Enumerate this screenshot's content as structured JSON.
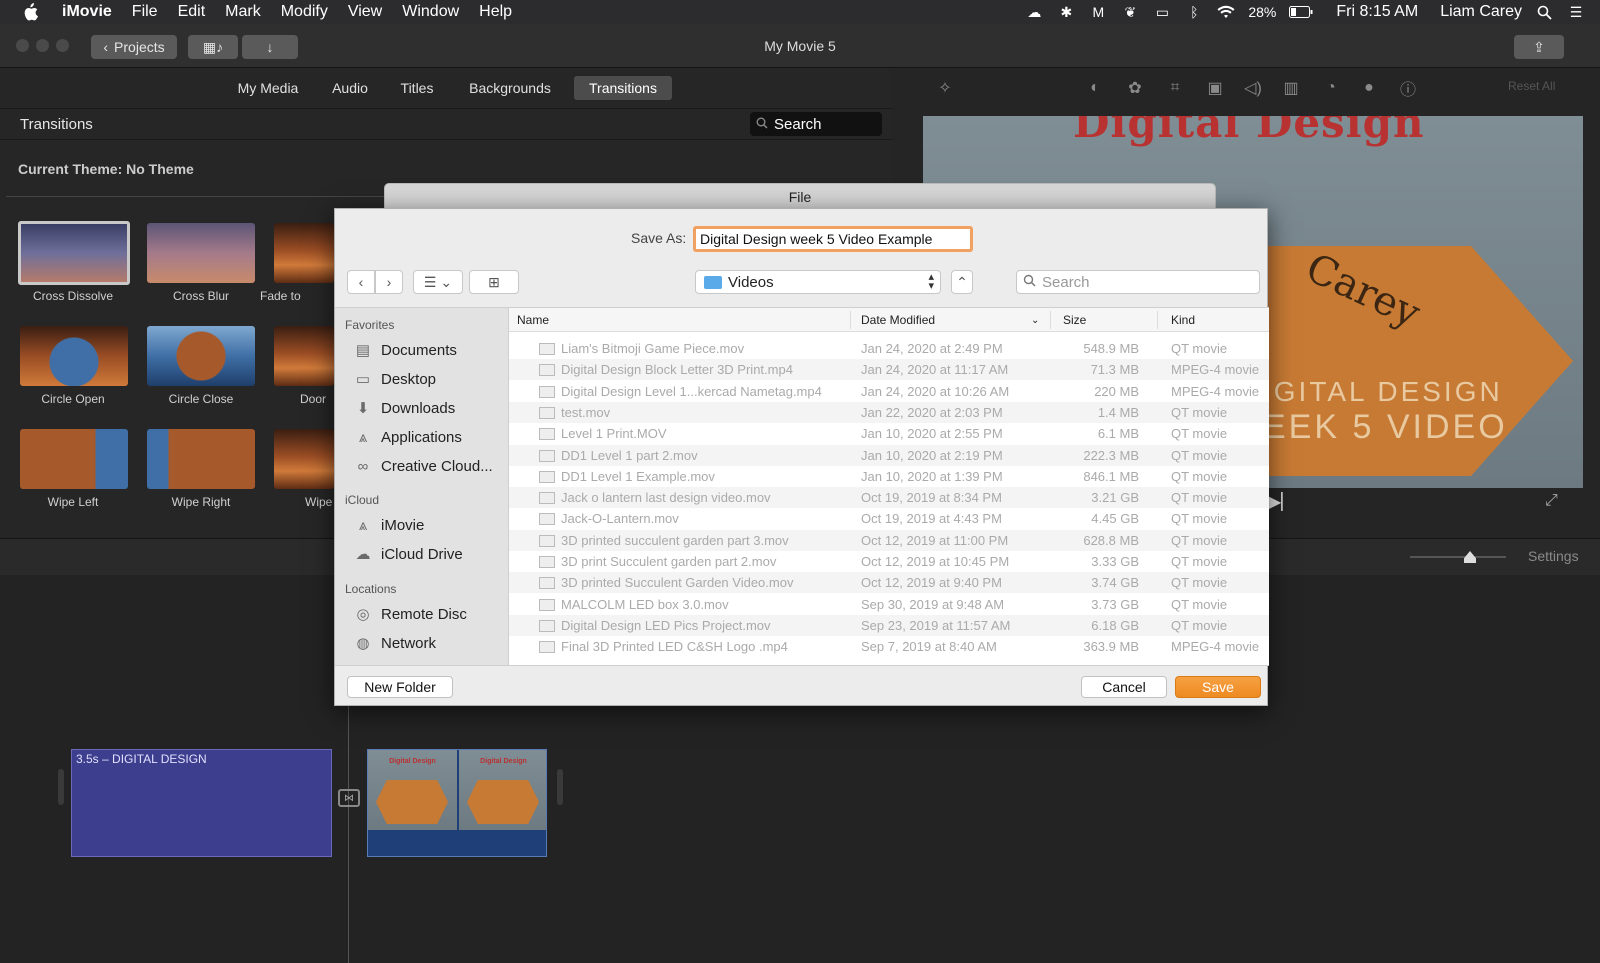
{
  "menubar": {
    "app_name": "iMovie",
    "items": [
      "File",
      "Edit",
      "Mark",
      "Modify",
      "View",
      "Window",
      "Help"
    ],
    "battery": "28%",
    "clock": "Fri 8:15 AM",
    "user": "Liam Carey"
  },
  "toolbar": {
    "projects_label": "Projects",
    "window_title": "My Movie 5"
  },
  "browser": {
    "tabs": [
      "My Media",
      "Audio",
      "Titles",
      "Backgrounds",
      "Transitions"
    ],
    "active_tab": "Transitions",
    "section_title": "Transitions",
    "search_label": "Search",
    "theme_label": "Current Theme: No Theme",
    "transitions": [
      "Cross Dissolve",
      "Cross Blur",
      "Fade to",
      "Circle Open",
      "Circle Close",
      "Door",
      "Wipe Left",
      "Wipe Right",
      "Wipe"
    ]
  },
  "viewer": {
    "reset_all": "Reset All",
    "preview_title": "Digital Design",
    "preview_arc_text": "Carey",
    "preview_line1": "IGITAL DESIGN",
    "preview_line2": "EEK 5  VIDEO"
  },
  "timeline": {
    "settings_label": "Settings",
    "title_clip_label": "3.5s – DIGITAL DESIGN",
    "frame_title": "Digital Design"
  },
  "save_sheet": {
    "title": "File",
    "save_as_label": "Save As:",
    "file_name": "Digital Design week 5 Video Example",
    "location": "Videos",
    "search_placeholder": "Search",
    "sidebar": {
      "favorites_heading": "Favorites",
      "favorites": [
        "Documents",
        "Desktop",
        "Downloads",
        "Applications",
        "Creative Cloud..."
      ],
      "icloud_heading": "iCloud",
      "icloud": [
        "iMovie",
        "iCloud Drive"
      ],
      "locations_heading": "Locations",
      "locations": [
        "Remote Disc",
        "Network"
      ]
    },
    "columns": {
      "name": "Name",
      "date": "Date Modified",
      "size": "Size",
      "kind": "Kind"
    },
    "files": [
      {
        "name": "Liam's Bitmoji Game Piece.mov",
        "date": "Jan 24, 2020 at 2:49 PM",
        "size": "548.9 MB",
        "kind": "QT movie"
      },
      {
        "name": "Digital Design Block Letter 3D Print.mp4",
        "date": "Jan 24, 2020 at 11:17 AM",
        "size": "71.3 MB",
        "kind": "MPEG-4 movie"
      },
      {
        "name": "Digital Design Level 1...kercad Nametag.mp4",
        "date": "Jan 24, 2020 at 10:26 AM",
        "size": "220 MB",
        "kind": "MPEG-4 movie"
      },
      {
        "name": "test.mov",
        "date": "Jan 22, 2020 at 2:03 PM",
        "size": "1.4 MB",
        "kind": "QT movie"
      },
      {
        "name": "Level 1 Print.MOV",
        "date": "Jan 10, 2020 at 2:55 PM",
        "size": "6.1 MB",
        "kind": "QT movie"
      },
      {
        "name": "DD1 Level 1 part 2.mov",
        "date": "Jan 10, 2020 at 2:19 PM",
        "size": "222.3 MB",
        "kind": "QT movie"
      },
      {
        "name": "DD1 Level 1 Example.mov",
        "date": "Jan 10, 2020 at 1:39 PM",
        "size": "846.1 MB",
        "kind": "QT movie"
      },
      {
        "name": "Jack o lantern last design video.mov",
        "date": "Oct 19, 2019 at 8:34 PM",
        "size": "3.21 GB",
        "kind": "QT movie"
      },
      {
        "name": "Jack-O-Lantern.mov",
        "date": "Oct 19, 2019 at 4:43 PM",
        "size": "4.45 GB",
        "kind": "QT movie"
      },
      {
        "name": "3D printed succulent garden part 3.mov",
        "date": "Oct 12, 2019 at 11:00 PM",
        "size": "628.8 MB",
        "kind": "QT movie"
      },
      {
        "name": "3D print Succulent garden part 2.mov",
        "date": "Oct 12, 2019 at 10:45 PM",
        "size": "3.33 GB",
        "kind": "QT movie"
      },
      {
        "name": "3D printed Succulent Garden Video.mov",
        "date": "Oct 12, 2019 at 9:40 PM",
        "size": "3.74 GB",
        "kind": "QT movie"
      },
      {
        "name": "MALCOLM LED box 3.0.mov",
        "date": "Sep 30, 2019 at 9:48 AM",
        "size": "3.73 GB",
        "kind": "QT movie"
      },
      {
        "name": "Digital Design LED Pics Project.mov",
        "date": "Sep 23, 2019 at 11:57 AM",
        "size": "6.18 GB",
        "kind": "QT movie"
      },
      {
        "name": "Final 3D Printed LED C&SH Logo .mp4",
        "date": "Sep 7, 2019 at 8:40 AM",
        "size": "363.9 MB",
        "kind": "MPEG-4 movie"
      }
    ],
    "new_folder_label": "New Folder",
    "cancel_label": "Cancel",
    "save_label": "Save"
  }
}
